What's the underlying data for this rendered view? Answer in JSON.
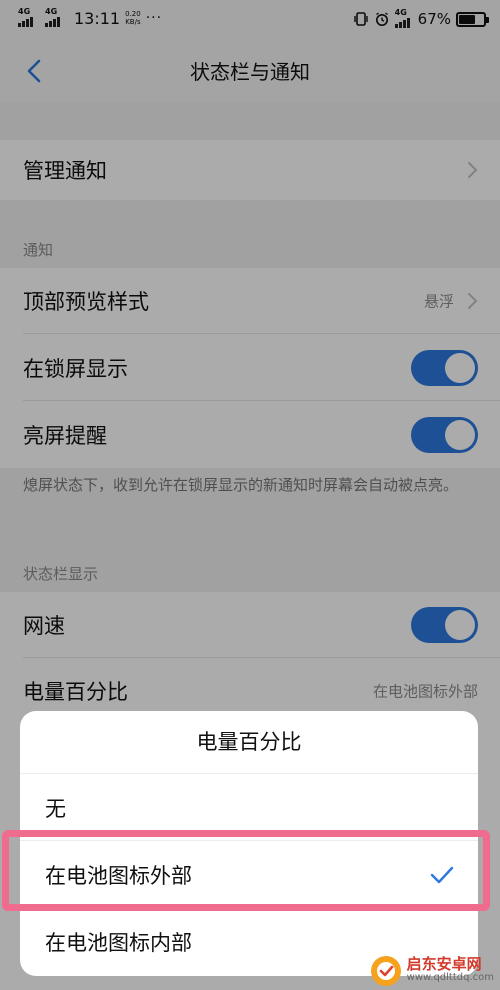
{
  "status_bar": {
    "sim1_label": "4G",
    "sim2_label": "4G",
    "time": "13:11",
    "net_speed_value": "0.20",
    "net_speed_unit": "KB/s",
    "more_dots": "···",
    "right_net_label": "4G",
    "battery_percent_text": "67%",
    "battery_level": 0.67
  },
  "header": {
    "title": "状态栏与通知"
  },
  "settings": {
    "manage": {
      "label": "管理通知"
    },
    "section_notify": "通知",
    "preview": {
      "label": "顶部预览样式",
      "value": "悬浮"
    },
    "lockscreen": {
      "label": "在锁屏显示",
      "on": true
    },
    "wake": {
      "label": "亮屏提醒",
      "on": true
    },
    "wake_hint": "熄屏状态下，收到允许在锁屏显示的新通知时屏幕会自动被点亮。",
    "section_statusbar": "状态栏显示",
    "netspeed": {
      "label": "网速",
      "on": true
    },
    "battery_pct": {
      "label": "电量百分比",
      "value": "在电池图标外部"
    }
  },
  "sheet": {
    "title": "电量百分比",
    "options": [
      {
        "label": "无",
        "selected": false
      },
      {
        "label": "在电池图标外部",
        "selected": true
      },
      {
        "label": "在电池图标内部",
        "selected": false
      }
    ]
  },
  "watermark": {
    "name": "启东安卓网",
    "url": "www.qdlttdq.com"
  },
  "colors": {
    "accent": "#2d78e0",
    "highlight": "#ef6c8e"
  }
}
